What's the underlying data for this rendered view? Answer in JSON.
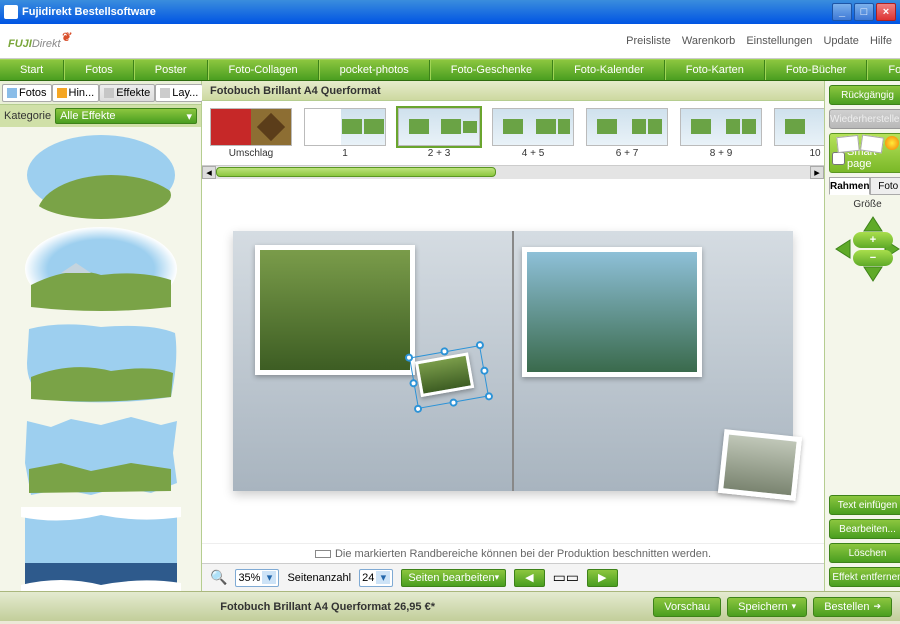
{
  "window": {
    "title": "Fujidirekt Bestellsoftware"
  },
  "header": {
    "links": [
      "Preisliste",
      "Warenkorb",
      "Einstellungen",
      "Update",
      "Hilfe"
    ]
  },
  "menu": [
    "Start",
    "Fotos",
    "Poster",
    "Foto-Collagen",
    "pocket-photos",
    "Foto-Geschenke",
    "Foto-Kalender",
    "Foto-Karten",
    "Foto-Bücher",
    "Foto-Manager"
  ],
  "leftTabs": [
    "Fotos",
    "Hin...",
    "Effekte",
    "Lay..."
  ],
  "category": {
    "label": "Kategorie",
    "selected": "Alle Effekte"
  },
  "center": {
    "title": "Fotobuch Brillant A4 Querformat",
    "pages": [
      {
        "label": "Umschlag"
      },
      {
        "label": "1"
      },
      {
        "label": "2 + 3",
        "selected": true
      },
      {
        "label": "4 + 5"
      },
      {
        "label": "6 + 7"
      },
      {
        "label": "8 + 9"
      },
      {
        "label": "10"
      }
    ],
    "cropMessage": "Die markierten Randbereiche können bei der Produktion beschnitten werden."
  },
  "toolbar": {
    "zoomValue": "35%",
    "pagesLabel": "Seitenanzahl",
    "pagesValue": "24",
    "editPages": "Seiten bearbeiten"
  },
  "right": {
    "undo": "Rückgängig",
    "redo": "Wiederherstellen",
    "smartPage": "Smart-page",
    "tabRahmen": "Rahmen",
    "tabFoto": "Foto",
    "size": "Größe",
    "insertText": "Text einfügen",
    "edit": "Bearbeiten...",
    "delete": "Löschen",
    "removeEffect": "Effekt entfernen"
  },
  "bottom": {
    "title": "Fotobuch Brillant A4 Querformat 26,95 €*",
    "preview": "Vorschau",
    "save": "Speichern",
    "order": "Bestellen"
  }
}
